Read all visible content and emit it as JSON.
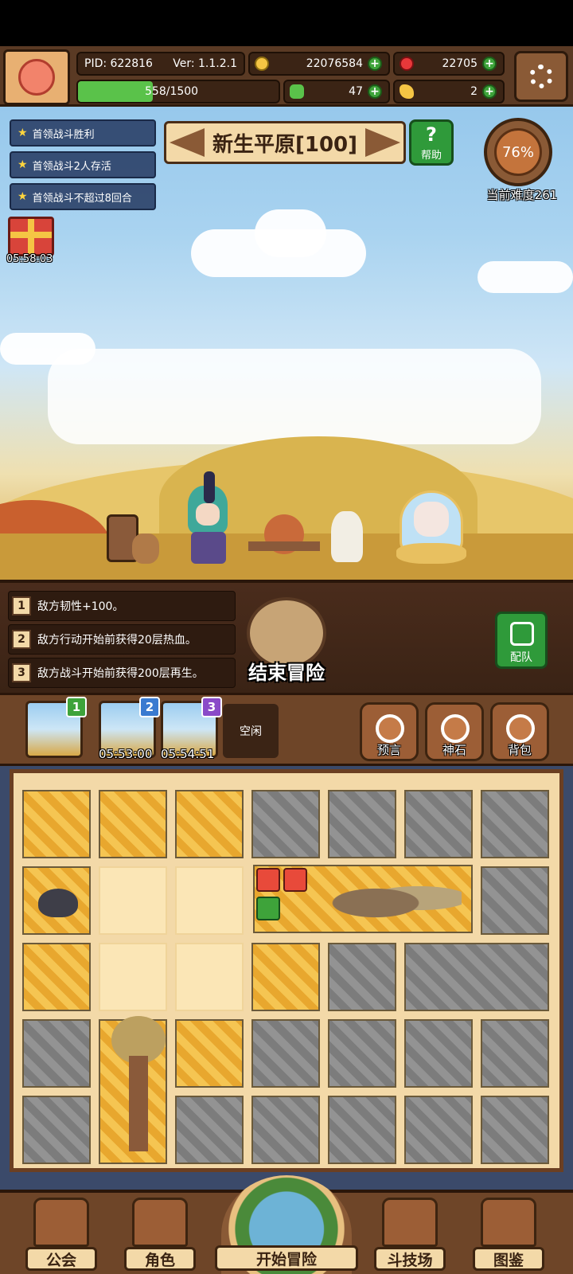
{
  "hud": {
    "pid": "PID: 622816",
    "version": "Ver: 1.1.2.1",
    "gold": "22076584",
    "gems": "22705",
    "stamina": "558/1500",
    "stamina_progress": 0.372,
    "clover": "47",
    "feather": "2"
  },
  "quests": [
    {
      "label": "首领战斗胜利"
    },
    {
      "label": "首领战斗2人存活"
    },
    {
      "label": "首领战斗不超过8回合"
    }
  ],
  "gift_timer": "05:58:03",
  "stage": {
    "title": "新生平原[100]"
  },
  "help": {
    "label": "帮助",
    "icon": "?"
  },
  "difficulty": {
    "percent": "76%",
    "label": "当前难度261"
  },
  "conditions": [
    {
      "num": "1",
      "text": "敌方韧性+100。"
    },
    {
      "num": "2",
      "text": "敌方行动开始前获得20层热血。"
    },
    {
      "num": "3",
      "text": "敌方战斗开始前获得200层再生。"
    }
  ],
  "end_button": "结束冒险",
  "team_button": "配队",
  "slots": [
    {
      "num": "1",
      "timer": "",
      "color": "#3ea33a"
    },
    {
      "num": "2",
      "timer": "05:53:00",
      "color": "#3a7ad0"
    },
    {
      "num": "3",
      "timer": "05:54:51",
      "color": "#8a4ac8"
    }
  ],
  "slot_empty": "空闲",
  "side_buttons": [
    {
      "label": "预言",
      "icon": "crystal-ball-icon"
    },
    {
      "label": "神石",
      "icon": "stone-icon"
    },
    {
      "label": "背包",
      "icon": "backpack-icon"
    }
  ],
  "nav": {
    "guild": "公会",
    "character": "角色",
    "start": "开始冒险",
    "arena": "斗技场",
    "codex": "图鉴"
  },
  "colors": {
    "gold_tile": "#f0b43a",
    "gray_tile": "#8b8b8b",
    "frame": "#6e4528"
  }
}
